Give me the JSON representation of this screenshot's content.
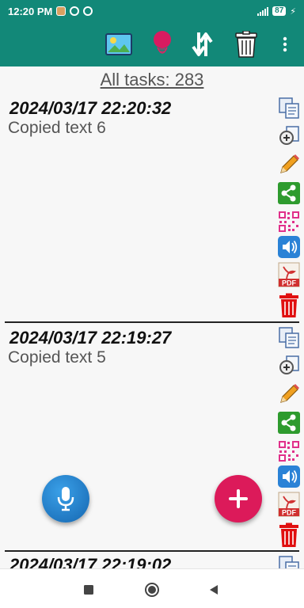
{
  "status_bar": {
    "time": "12:20 PM",
    "battery": "87"
  },
  "toolbar": {
    "icons": [
      "image-icon",
      "balloon-icon",
      "sort-arrows-icon",
      "trash-icon",
      "more-vert-icon"
    ]
  },
  "header": {
    "count_label": "All tasks: 283"
  },
  "tasks": [
    {
      "date": "2024/03/17 22:20:32",
      "text": "Copied text 6"
    },
    {
      "date": "2024/03/17 22:19:27",
      "text": "Copied text 5"
    },
    {
      "date": "2024/03/17 22:19:02",
      "text": ""
    }
  ],
  "task_actions": {
    "pdf_label": "PDF"
  },
  "colors": {
    "primary": "#128878",
    "accent": "#dc1a5a",
    "mic": "#1e78c8",
    "share": "#2e9b2e",
    "delete": "#e01010",
    "edit": "#f0a020"
  }
}
